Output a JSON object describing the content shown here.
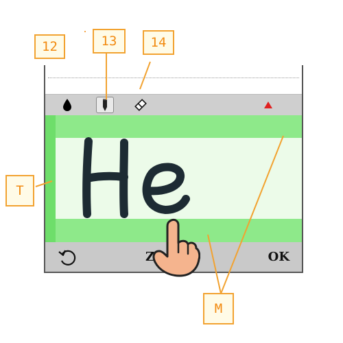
{
  "callouts": {
    "c12": "12",
    "c13": "13",
    "c14": "14",
    "cT": "T",
    "cM": "M"
  },
  "toolbar": {
    "tools": [
      {
        "icon": "ink-drop-icon"
      },
      {
        "icon": "pen-icon",
        "selected": true
      },
      {
        "icon": "eraser-icon"
      }
    ],
    "menu_icon": "triangle-up-icon",
    "accent_color": "#e02020"
  },
  "writing_area": {
    "text": "He",
    "band_color": "#8ee98a",
    "inner_color": "#ecfbe9"
  },
  "bottombar": {
    "rotate_icon": "rotate-icon",
    "zoom_label": "ZOOM",
    "ok_label": "OK"
  }
}
